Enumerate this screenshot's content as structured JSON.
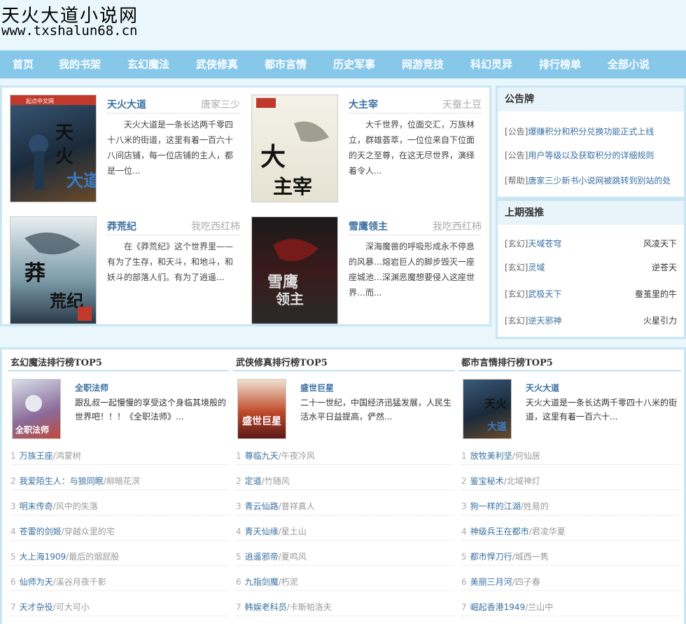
{
  "site": {
    "title": "天火大道小说网",
    "url": "www.txshalun68.cn"
  },
  "nav": [
    "首页",
    "我的书架",
    "玄幻魔法",
    "武侠修真",
    "都市言情",
    "历史军事",
    "网游竞技",
    "科幻灵异",
    "排行榜单",
    "全部小说"
  ],
  "featured": [
    {
      "title": "天火大道",
      "author": "唐家三少",
      "desc": "天火大道是一条长达两千零四十八米的街道，这里有着一百六十八间店铺，每一位店铺的主人，都是一位..."
    },
    {
      "title": "大主宰",
      "author": "天蚕土豆",
      "desc": "大千世界，位面交汇，万族林立，群雄荟萃，一位位来自下位面的天之至尊，在这无尽世界，演绎着令人..."
    },
    {
      "title": "莽荒纪",
      "author": "我吃西红柿",
      "desc": "在《莽荒纪》这个世界里——有为了生存，和天斗，和地斗，和妖斗的部落人们。有为了逍遥..."
    },
    {
      "title": "雪鹰领主",
      "author": "我吃西红柿",
      "desc": "深海魔兽的呼吸形成永不停息的风暴…熔岩巨人的脚步毁灭一座座城池…深渊恶魔想要侵入这座世界…而..."
    }
  ],
  "notice": {
    "heading": "公告牌",
    "items": [
      {
        "tag": "[公告]",
        "text": "爆赚积分和积分兑换功能正式上线"
      },
      {
        "tag": "[公告]",
        "text": "用户等级以及获取积分的详细规则"
      },
      {
        "tag": "[帮助]",
        "text": "唐家三少新书小说网被跳转到别站的处"
      }
    ]
  },
  "last_top": {
    "heading": "上期强推",
    "items": [
      {
        "tag": "[玄幻]",
        "name": "天域苍穹",
        "author": "风凌天下"
      },
      {
        "tag": "[玄幻]",
        "name": "灵域",
        "author": "逆苍天"
      },
      {
        "tag": "[玄幻]",
        "name": "武极天下",
        "author": "蚕茧里的牛"
      },
      {
        "tag": "[玄幻]",
        "name": "逆天邪神",
        "author": "火星引力"
      }
    ]
  },
  "rankings": [
    {
      "title": "玄幻魔法排行榜TOP5",
      "top": {
        "name": "全职法师",
        "desc": "跟乱叔一起慢慢的享受这个身临其境般的世界吧！！！《全职法师》..."
      },
      "items": [
        {
          "n": "1",
          "name": "万族王座",
          "author": "鸿蒙树"
        },
        {
          "n": "2",
          "name": "我爱陌生人：与狼同眠",
          "author": "柳暗花溟"
        },
        {
          "n": "3",
          "name": "明末传奇",
          "author": "风中的失落"
        },
        {
          "n": "4",
          "name": "苍雷的剑姬",
          "author": "穿越众里的宅"
        },
        {
          "n": "5",
          "name": "大上海1909",
          "author": "最后的烟屁股"
        },
        {
          "n": "6",
          "name": "仙师为天",
          "author": "溪谷月夜千影"
        },
        {
          "n": "7",
          "name": "天才杂役",
          "author": "可大可小"
        }
      ]
    },
    {
      "title": "武侠修真排行榜TOP5",
      "top": {
        "name": "盛世巨星",
        "desc": "二十一世纪，中国经济迅猛发展，人民生活水平日益提高，俨然..."
      },
      "items": [
        {
          "n": "1",
          "name": "尊临九天",
          "author": "午夜冷风"
        },
        {
          "n": "2",
          "name": "定道",
          "author": "竹随风"
        },
        {
          "n": "3",
          "name": "青云仙路",
          "author": "普祥真人"
        },
        {
          "n": "4",
          "name": "青天仙缘",
          "author": "星土山"
        },
        {
          "n": "5",
          "name": "逍遥邪帝",
          "author": "夏鸣风"
        },
        {
          "n": "6",
          "name": "九指剑魔",
          "author": "朽泥"
        },
        {
          "n": "7",
          "name": "韩娱老科员",
          "author": "卡斯帕洛夫"
        }
      ]
    },
    {
      "title": "都市言情排行榜TOP5",
      "top": {
        "name": "天火大道",
        "desc": "天火大道是一条长达两千零四十八米的街道，这里有着一百六十..."
      },
      "items": [
        {
          "n": "1",
          "name": "放牧美利坚",
          "author": "何仙居"
        },
        {
          "n": "2",
          "name": "鉴宝秘术",
          "author": "北域神灯"
        },
        {
          "n": "3",
          "name": "狗一样的江湖",
          "author": "姓易的"
        },
        {
          "n": "4",
          "name": "神级兵王在都市",
          "author": "君凌华夏"
        },
        {
          "n": "5",
          "name": "都市悍刀行",
          "author": "城西一隽"
        },
        {
          "n": "6",
          "name": "美丽三月河",
          "author": "四子春"
        },
        {
          "n": "7",
          "name": "崛起香港1949",
          "author": "兰山中"
        }
      ]
    }
  ]
}
